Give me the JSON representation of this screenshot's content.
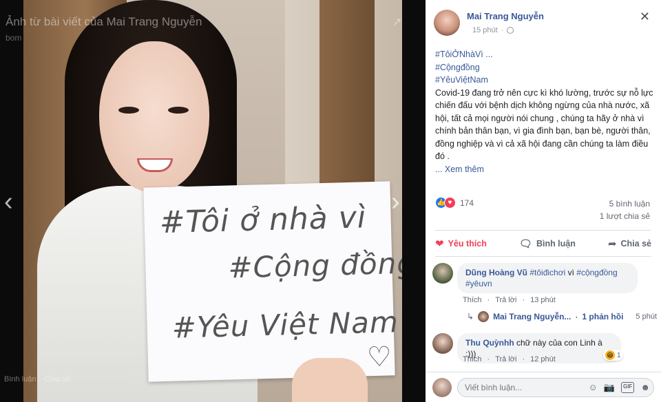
{
  "viewer": {
    "title": "Ảnh từ bài viết của Mai Trang Nguyễn",
    "subtitle": "bom",
    "prev_glyph": "‹",
    "next_glyph": "›",
    "close_glyph": "↗",
    "sign": {
      "line1": "#Tôi ở nhà vì",
      "line2": "#Cộng đồng",
      "line3": "#Yêu Việt Nam",
      "heart": "♡"
    },
    "actions": [
      "Bình luận",
      "Chia sẻ"
    ]
  },
  "post": {
    "author": "Mai Trang Nguyễn",
    "time": "15 phút",
    "close_glyph": "✕",
    "hashtags": [
      "#TôiỞNhàVì ...",
      "#Cộngđồng",
      "#YêuViệtNam"
    ],
    "text": "Covid-19 đang trở nên cực kì khó lường, trước sự nỗ lực chiến đấu với bệnh dịch không ngừng của nhà nước, xã hội, tất cả mọi người nói chung , chúng ta hãy ở nhà vì chính bản thân bạn, vì gia đình bạn, bạn bè, người thân, đồng nghiệp và vì cả xã hội đang cần chúng ta làm điều đó .",
    "see_more": "... Xem thêm",
    "reaction_count": "174",
    "comments_count": "5 bình luận",
    "shares_count": "1 lượt chia sẻ",
    "actions": {
      "like": "Yêu thích",
      "comment": "Bình luận",
      "share": "Chia sẻ"
    }
  },
  "comments": [
    {
      "author": "Dũng Hoàng Vũ",
      "tag1": "#tôiđichơi",
      "mid": " vì ",
      "tag2": "#cộngđồng",
      "tag3": "#yêuvn",
      "reply_label": "Thích",
      "reply_link": "Trả lời",
      "time": "13 phút",
      "reply": {
        "name": "Mai Trang Nguyễn...",
        "sep": "·",
        "count": "1 phản hồi",
        "time": "5 phút"
      }
    },
    {
      "author": "Thu Quỳnhh",
      "text": " chữ này của con Linh à :)))",
      "reply_label": "Thích",
      "reply_link": "Trả lời",
      "time": "12 phút",
      "reaction_count": "1"
    }
  ],
  "composer": {
    "placeholder": "Viết bình luận..."
  },
  "colors": {
    "link": "#385898",
    "love": "#f33e58",
    "like": "#1877f2"
  }
}
